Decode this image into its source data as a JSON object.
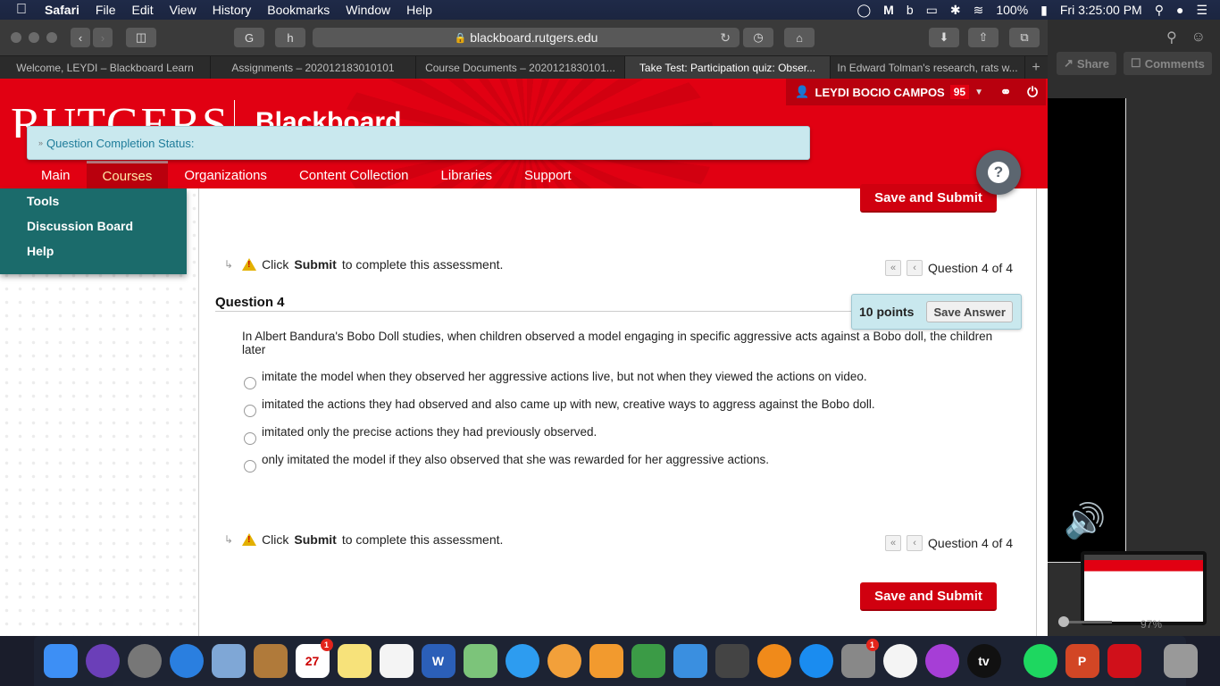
{
  "menubar": {
    "apple": "",
    "app": "Safari",
    "items": [
      "File",
      "Edit",
      "View",
      "History",
      "Bookmarks",
      "Window",
      "Help"
    ],
    "battery": "100%",
    "clock": "Fri 3:25:00 PM"
  },
  "browser": {
    "url": "blackboard.rutgers.edu",
    "tabs": [
      {
        "label": "Welcome, LEYDI – Blackboard Learn",
        "active": false
      },
      {
        "label": "Assignments – 202012183010101",
        "active": false
      },
      {
        "label": "Course Documents – 2020121830101...",
        "active": false
      },
      {
        "label": "Take Test: Participation quiz: Obser...",
        "active": true
      },
      {
        "label": "In Edward Tolman's research, rats w...",
        "active": false
      }
    ],
    "new_tab": "+"
  },
  "header": {
    "logo": "RUTGERS",
    "product": "Blackboard",
    "user_name": "LEYDI BOCIO CAMPOS",
    "notification_count": "95",
    "completion_status": "Question Completion Status:",
    "nav": [
      {
        "label": "Main",
        "active": false
      },
      {
        "label": "Courses",
        "active": true
      },
      {
        "label": "Organizations",
        "active": false
      },
      {
        "label": "Content Collection",
        "active": false
      },
      {
        "label": "Libraries",
        "active": false
      },
      {
        "label": "Support",
        "active": false
      }
    ],
    "help": "?"
  },
  "sidebar": {
    "items": [
      "Tools",
      "Discussion Board",
      "Help"
    ]
  },
  "test": {
    "save_submit": "Save and Submit",
    "instruction_pre": "Click",
    "instruction_bold": "Submit",
    "instruction_post": "to complete this assessment.",
    "question_nav": "Question 4 of 4",
    "question_title": "Question 4",
    "points": "10 points",
    "save_answer": "Save Answer",
    "question_text": "In Albert Bandura's Bobo Doll studies, when children observed a model engaging in specific aggressive acts against a Bobo doll, the children later",
    "options": [
      "imitate the model when they observed her aggressive actions live, but not when they viewed the actions on video.",
      "imitated the actions they had observed and also came up with new, creative ways to aggress against the Bobo doll.",
      "imitated only the precise actions they had previously observed.",
      "only imitated the model if they also observed that she was rewarded for her aggressive actions."
    ]
  },
  "right_pane": {
    "share": "Share",
    "comments": "Comments",
    "zoom_level": "97%"
  },
  "dock": {
    "apps": [
      {
        "name": "Finder",
        "color": "#3d8ff5"
      },
      {
        "name": "Siri",
        "color": "#6b3fb8"
      },
      {
        "name": "Launchpad",
        "color": "#777"
      },
      {
        "name": "Safari",
        "color": "#2a7fe0"
      },
      {
        "name": "Mail",
        "color": "#7fa7d6"
      },
      {
        "name": "Contacts",
        "color": "#b07a3a"
      },
      {
        "name": "Calendar",
        "color": "#fff",
        "badge": "1",
        "text": "27"
      },
      {
        "name": "Notes",
        "color": "#f7e27a"
      },
      {
        "name": "Reminders",
        "color": "#f4f4f4"
      },
      {
        "name": "Word",
        "color": "#2b5fb8",
        "text": "W"
      },
      {
        "name": "Maps",
        "color": "#7cc47a"
      },
      {
        "name": "Messages",
        "color": "#2d9cf0"
      },
      {
        "name": "Photos",
        "color": "#f2a03a"
      },
      {
        "name": "Pages",
        "color": "#f29a2e"
      },
      {
        "name": "Numbers",
        "color": "#3b9b46"
      },
      {
        "name": "Keynote",
        "color": "#3a8fe0"
      },
      {
        "name": "Scanner",
        "color": "#444"
      },
      {
        "name": "Books",
        "color": "#f08a1a"
      },
      {
        "name": "App Store",
        "color": "#1a8cf0"
      },
      {
        "name": "System Preferences",
        "color": "#888",
        "badge": "1"
      },
      {
        "name": "News",
        "color": "#f4f4f4"
      },
      {
        "name": "Podcasts",
        "color": "#a63ed6"
      },
      {
        "name": "Apple TV",
        "color": "#111",
        "text": "tv"
      },
      {
        "name": "Spotify",
        "color": "#1ed760"
      },
      {
        "name": "PowerPoint",
        "color": "#d24625",
        "text": "P"
      },
      {
        "name": "Acrobat",
        "color": "#d0101a"
      },
      {
        "name": "Trash",
        "color": "#999"
      }
    ]
  }
}
